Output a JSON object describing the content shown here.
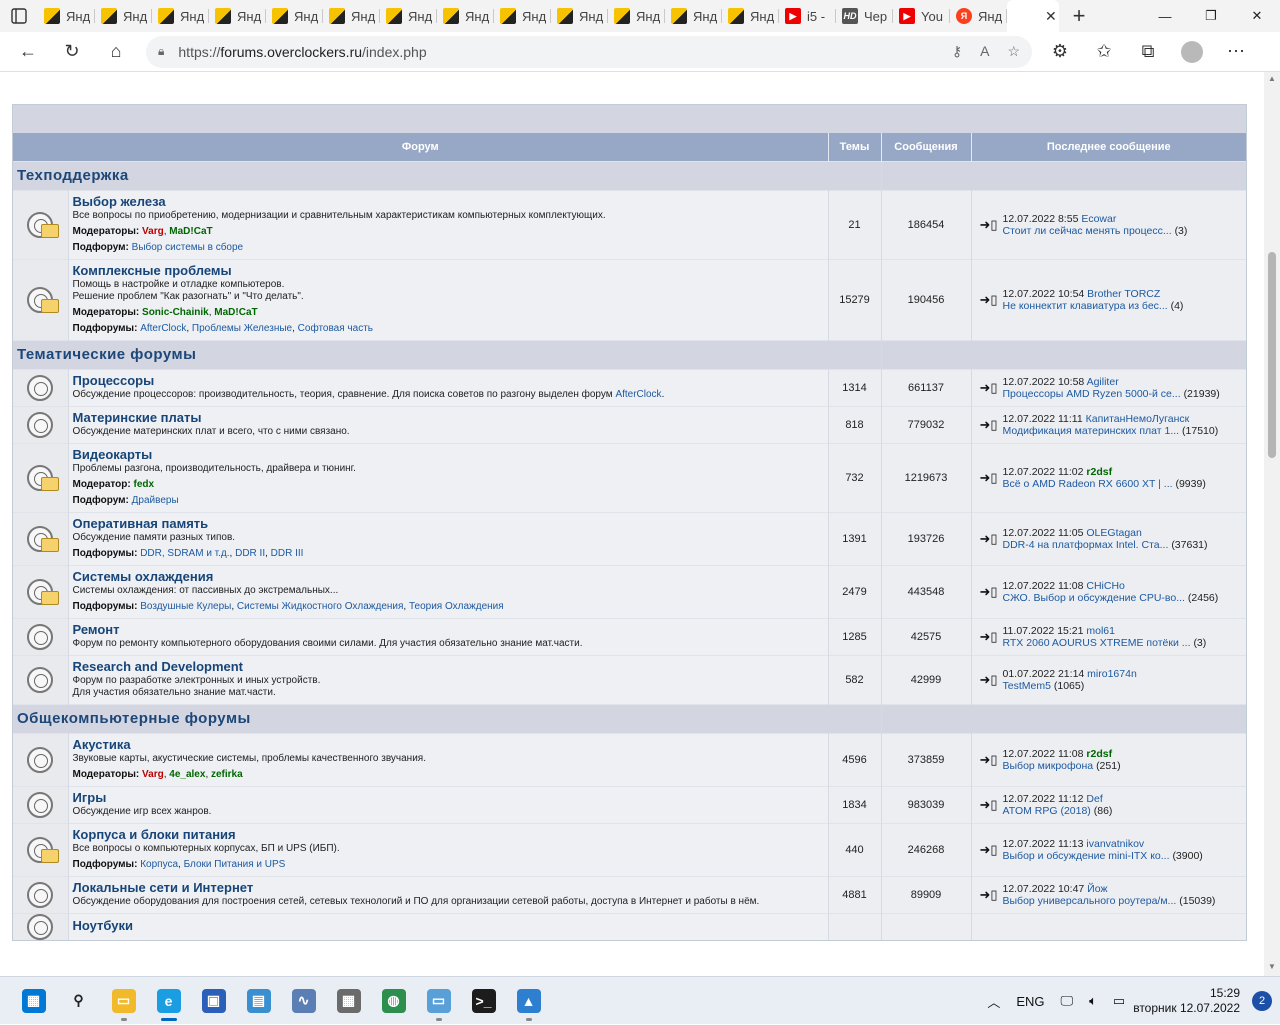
{
  "browser": {
    "tabs": [
      {
        "label": "Янд",
        "favicon": "yandex-images-icon"
      },
      {
        "label": "Янд",
        "favicon": "yandex-images-icon"
      },
      {
        "label": "Янд",
        "favicon": "yandex-images-icon"
      },
      {
        "label": "Янд",
        "favicon": "yandex-images-icon"
      },
      {
        "label": "Янд",
        "favicon": "yandex-images-icon"
      },
      {
        "label": "Янд",
        "favicon": "yandex-images-icon"
      },
      {
        "label": "Янд",
        "favicon": "yandex-images-icon"
      },
      {
        "label": "Янд",
        "favicon": "yandex-images-icon"
      },
      {
        "label": "Янд",
        "favicon": "yandex-images-icon"
      },
      {
        "label": "Янд",
        "favicon": "yandex-images-icon"
      },
      {
        "label": "Янд",
        "favicon": "yandex-images-icon"
      },
      {
        "label": "Янд",
        "favicon": "yandex-images-icon"
      },
      {
        "label": "Янд",
        "favicon": "yandex-images-icon"
      },
      {
        "label": "i5 -",
        "favicon": "youtube-icon"
      },
      {
        "label": "Чер",
        "favicon": "hd-icon"
      },
      {
        "label": "You",
        "favicon": "youtube-icon"
      },
      {
        "label": "Янд",
        "favicon": "yandex-icon"
      }
    ],
    "url_scheme": "https://",
    "url_host": "forums.overclockers.ru",
    "url_path": "/index.php"
  },
  "table_headers": {
    "forum": "Форум",
    "topics": "Темы",
    "posts": "Сообщения",
    "last_post": "Последнее сообщение"
  },
  "categories": [
    {
      "name": "Техподдержка",
      "forums": [
        {
          "title": "Выбор железа",
          "desc": "Все вопросы по приобретению, модернизации и сравнительным характеристикам компьютерных комплектующих.",
          "moderators_label": "Модераторы:",
          "moderators": [
            {
              "name": "Varg",
              "color": "red"
            },
            {
              "name": "MaD!CaT",
              "color": "green"
            }
          ],
          "sub_label": "Подфорум:",
          "subforums": [
            "Выбор системы в сборе"
          ],
          "icon": "folder",
          "topics": "21",
          "posts": "186454",
          "last_date": "12.07.2022 8:55",
          "last_user": "Ecowar",
          "last_user_green": false,
          "last_topic": "Стоит ли сейчас менять процесс...",
          "last_count": "(3)"
        },
        {
          "title": "Комплексные проблемы",
          "desc": "Помощь в настройке и отладке компьютеров.",
          "desc2": "Решение проблем \"Как разогнать\" и \"Что делать\".",
          "moderators_label": "Модераторы:",
          "moderators": [
            {
              "name": "Sonic-Chainik",
              "color": "green"
            },
            {
              "name": "MaD!CaT",
              "color": "green"
            }
          ],
          "sub_label": "Подфорумы:",
          "subforums": [
            "AfterClock",
            "Проблемы Железные",
            "Софтовая часть"
          ],
          "icon": "folder",
          "topics": "15279",
          "posts": "190456",
          "last_date": "12.07.2022 10:54",
          "last_user": "Brother TORCZ",
          "last_user_green": false,
          "last_topic": "Не коннектит клавиатура из бес...",
          "last_count": "(4)"
        }
      ]
    },
    {
      "name": "Тематические форумы",
      "forums": [
        {
          "title": "Процессоры",
          "desc": "Обсуждение процессоров: производительность, теория, сравнение. Для поиска советов по разгону выделен форум ",
          "desc_link": "AfterClock",
          "desc_tail": ".",
          "icon": "plain",
          "topics": "1314",
          "posts": "661137",
          "last_date": "12.07.2022 10:58",
          "last_user": "Agiliter",
          "last_user_green": false,
          "last_topic": "Процессоры AMD Ryzen 5000-й се...",
          "last_count": "(21939)"
        },
        {
          "title": "Материнские платы",
          "desc": "Обсуждение материнских плат и всего, что с ними связано.",
          "icon": "plain",
          "topics": "818",
          "posts": "779032",
          "last_date": "12.07.2022 11:11",
          "last_user": "КапитанНемоЛуганск",
          "last_user_green": false,
          "last_topic": "Модификация материнских плат 1...",
          "last_count": "(17510)"
        },
        {
          "title": "Видеокарты",
          "desc": "Проблемы разгона, производительность, драйвера и тюнинг.",
          "moderators_label": "Модератор:",
          "moderators": [
            {
              "name": "fedx",
              "color": "green"
            }
          ],
          "sub_label": "Подфорум:",
          "subforums": [
            "Драйверы"
          ],
          "icon": "folder",
          "topics": "732",
          "posts": "1219673",
          "last_date": "12.07.2022 11:02",
          "last_user": "r2dsf",
          "last_user_green": true,
          "last_topic": "Всё о AMD Radeon RX 6600 XT | ...",
          "last_count": "(9939)"
        },
        {
          "title": "Оперативная память",
          "desc": "Обсуждение памяти разных типов.",
          "sub_label": "Подфорумы:",
          "subforums": [
            "DDR, SDRAM и т.д.",
            "DDR II",
            "DDR III"
          ],
          "icon": "folder",
          "topics": "1391",
          "posts": "193726",
          "last_date": "12.07.2022 11:05",
          "last_user": "OLEGtagan",
          "last_user_green": false,
          "last_topic": "DDR-4 на платформах Intel. Ста...",
          "last_count": "(37631)"
        },
        {
          "title": "Системы охлаждения",
          "desc": "Системы охлаждения: от пассивных до экстремальных...",
          "sub_label": "Подфорумы:",
          "subforums": [
            "Воздушные Кулеры",
            "Системы Жидкостного Охлаждения",
            "Теория Охлаждения"
          ],
          "icon": "folder",
          "topics": "2479",
          "posts": "443548",
          "last_date": "12.07.2022 11:08",
          "last_user": "CHiCHo",
          "last_user_green": false,
          "last_topic": "СЖО. Выбор и обсуждение CPU-во...",
          "last_count": "(2456)"
        },
        {
          "title": "Ремонт",
          "desc": "Форум по ремонту компьютерного оборудования своими силами. Для участия обязательно знание мат.части.",
          "icon": "plain",
          "topics": "1285",
          "posts": "42575",
          "last_date": "11.07.2022 15:21",
          "last_user": "mol61",
          "last_user_green": false,
          "last_topic": "RTX 2060 AOURUS XTREME потёки ...",
          "last_count": "(3)"
        },
        {
          "title": "Research and Development",
          "desc": "Форум по разработке электронных и иных устройств.",
          "desc2": "Для участия обязательно знание мат.части.",
          "icon": "plain",
          "topics": "582",
          "posts": "42999",
          "last_date": "01.07.2022 21:14",
          "last_user": "miro1674n",
          "last_user_green": false,
          "last_topic": "TestMem5",
          "last_count": "(1065)"
        }
      ]
    },
    {
      "name": "Общекомпьютерные форумы",
      "forums": [
        {
          "title": "Акустика",
          "desc": "Звуковые карты, акустические системы, проблемы качественного звучания.",
          "moderators_label": "Модераторы:",
          "moderators": [
            {
              "name": "Varg",
              "color": "red"
            },
            {
              "name": "4e_alex",
              "color": "green"
            },
            {
              "name": "zefirka",
              "color": "green"
            }
          ],
          "icon": "plain",
          "topics": "4596",
          "posts": "373859",
          "last_date": "12.07.2022 11:08",
          "last_user": "r2dsf",
          "last_user_green": true,
          "last_topic": "Выбор микрофона",
          "last_count": "(251)"
        },
        {
          "title": "Игры",
          "desc": "Обсуждение игр всех жанров.",
          "icon": "plain",
          "topics": "1834",
          "posts": "983039",
          "last_date": "12.07.2022 11:12",
          "last_user": "Def",
          "last_user_green": false,
          "last_topic": "ATOM RPG (2018)",
          "last_count": "(86)"
        },
        {
          "title": "Корпуса и блоки питания",
          "desc": "Все вопросы о компьютерных корпусах, БП и UPS (ИБП).",
          "sub_label": "Подфорумы:",
          "subforums": [
            "Корпуса",
            "Блоки Питания и UPS"
          ],
          "icon": "folder",
          "topics": "440",
          "posts": "246268",
          "last_date": "12.07.2022 11:13",
          "last_user": "ivanvatnikov",
          "last_user_green": false,
          "last_topic": "Выбор и обсуждение mini-ITX ко...",
          "last_count": "(3900)"
        },
        {
          "title": "Локальные сети и Интернет",
          "desc": "Обсуждение оборудования для построения сетей, сетевых технологий и ПО для организации сетевой работы, доступа в Интернет и работы в нём.",
          "icon": "plain",
          "topics": "4881",
          "posts": "89909",
          "last_date": "12.07.2022 10:47",
          "last_user": "Йож",
          "last_user_green": false,
          "last_topic": "Выбор универсального роутера/м...",
          "last_count": "(15039)"
        },
        {
          "title": "Ноутбуки",
          "desc": "",
          "icon": "plain",
          "topics": "",
          "posts": "",
          "last_date": "",
          "last_user": "",
          "last_user_green": false,
          "last_topic": "",
          "last_count": ""
        }
      ]
    }
  ],
  "taskbar": {
    "apps": [
      "start-icon",
      "search-icon",
      "file-explorer-icon",
      "edge-icon",
      "store-icon",
      "photo-viewer-icon",
      "performance-monitor-icon",
      "calculator-icon",
      "network-icon",
      "app-icon",
      "terminal-icon",
      "photos-icon"
    ],
    "lang": "ENG",
    "time": "15:29",
    "date": "вторник 12.07.2022",
    "notification_count": "2"
  }
}
